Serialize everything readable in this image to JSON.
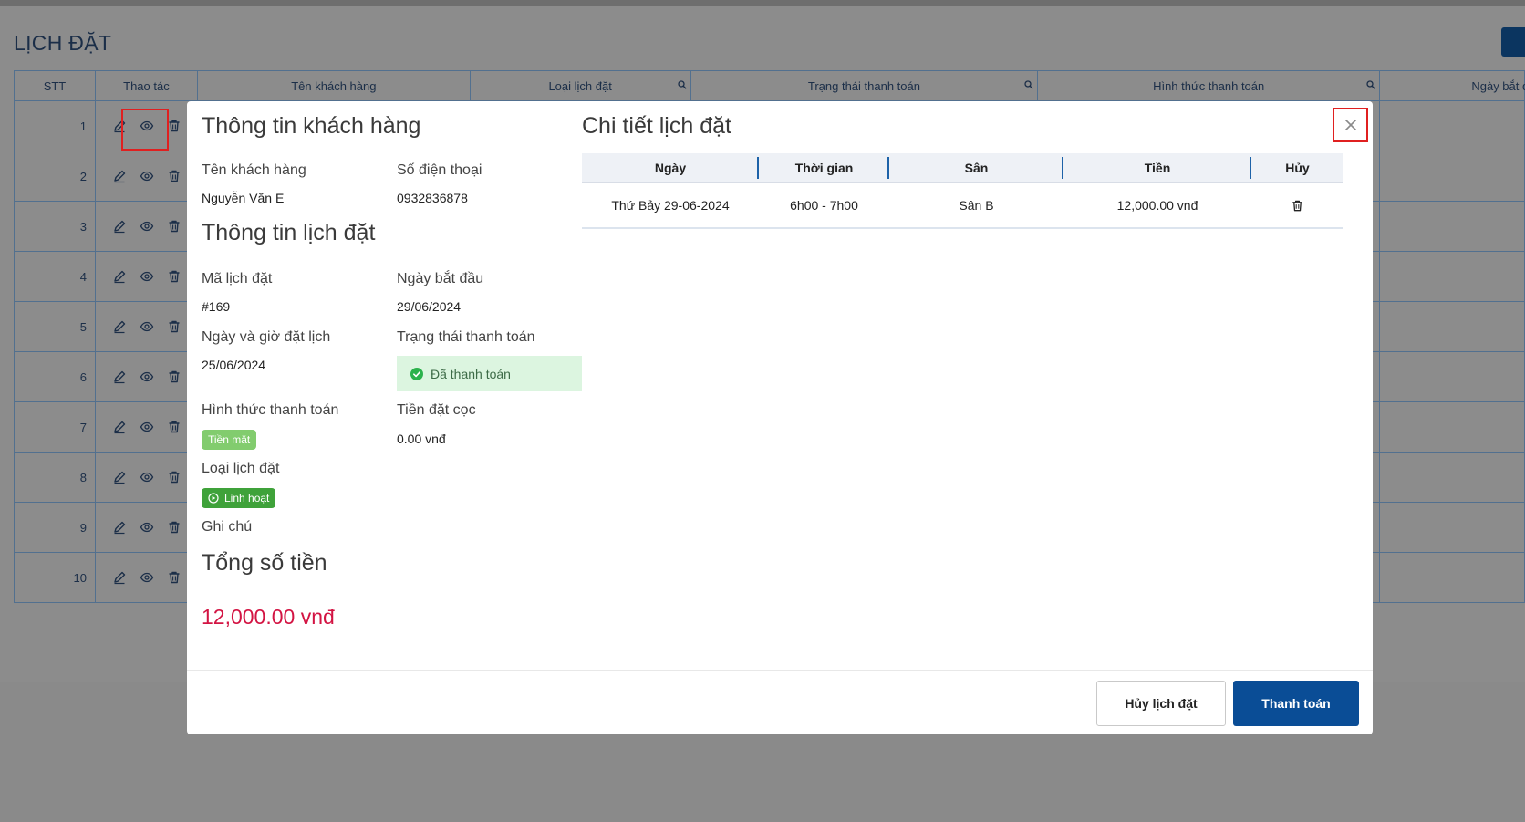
{
  "page": {
    "title": "LỊCH ĐẶT",
    "table": {
      "headers": [
        "STT",
        "Thao tác",
        "Tên khách hàng",
        "Loại lịch đặt",
        "Trạng thái thanh toán",
        "Hình thức thanh toán",
        "Ngày bắt đầu"
      ],
      "rows": [
        "1",
        "2",
        "3",
        "4",
        "5",
        "6",
        "7",
        "8",
        "9",
        "10"
      ]
    }
  },
  "modal": {
    "customer": {
      "heading": "Thông tin khách hàng",
      "name_label": "Tên khách hàng",
      "name_value": "Nguyễn Văn E",
      "phone_label": "Số điện thoại",
      "phone_value": "0932836878"
    },
    "booking": {
      "heading": "Thông tin lịch đặt",
      "code_label": "Mã lịch đặt",
      "code_value": "#169",
      "start_label": "Ngày bắt đầu",
      "start_value": "29/06/2024",
      "datetime_label": "Ngày và giờ đặt lịch",
      "datetime_value": "25/06/2024",
      "pay_status_label": "Trạng thái thanh toán",
      "pay_status_value": "Đã thanh toán",
      "pay_method_label": "Hình thức thanh toán",
      "pay_method_value": "Tiền mặt",
      "deposit_label": "Tiền đặt cọc",
      "deposit_value": "0.00 vnđ",
      "type_label": "Loại lịch đặt",
      "type_value": "Linh hoạt",
      "note_label": "Ghi chú"
    },
    "total": {
      "heading": "Tổng số tiền",
      "value": "12,000.00 vnđ"
    },
    "detail": {
      "heading": "Chi tiết lịch đặt",
      "columns": [
        "Ngày",
        "Thời gian",
        "Sân",
        "Tiền",
        "Hủy"
      ],
      "rows": [
        {
          "date": "Thứ Bảy 29-06-2024",
          "time": "6h00 - 7h00",
          "court": "Sân B",
          "price": "12,000.00 vnđ"
        }
      ]
    },
    "footer": {
      "cancel_label": "Hủy lịch đặt",
      "pay_label": "Thanh toán"
    },
    "icons": {
      "close": "close-icon",
      "edit": "pencil-icon",
      "view": "eye-icon",
      "delete": "trash-icon",
      "search": "search-icon",
      "check": "check-circle-icon"
    }
  }
}
